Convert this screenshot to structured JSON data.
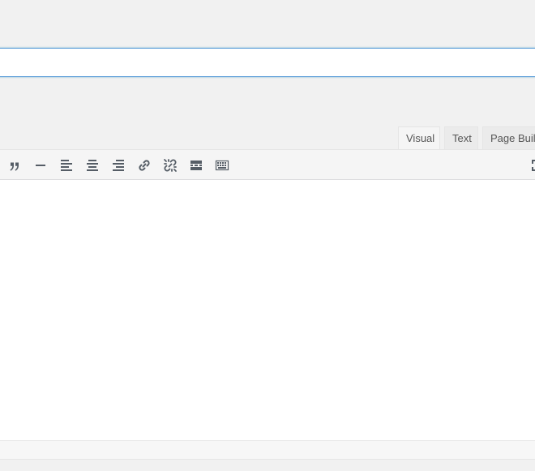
{
  "title_field": {
    "value": "",
    "placeholder": ""
  },
  "editor_tabs": {
    "visual": "Visual",
    "text": "Text",
    "page_builder": "Page Builder"
  },
  "toolbar": {
    "buttons": [
      "blockquote-icon",
      "horizontal-rule-icon",
      "align-left-icon",
      "align-center-icon",
      "align-right-icon",
      "insert-link-icon",
      "remove-link-icon",
      "read-more-icon",
      "toolbar-toggle-icon",
      "fullscreen-icon"
    ],
    "icon_color": "#555d66"
  },
  "editor": {
    "content": ""
  },
  "colors": {
    "focus_border": "#5b9dd9",
    "background": "#f1f1f1",
    "toolbar": "#f5f5f5"
  }
}
